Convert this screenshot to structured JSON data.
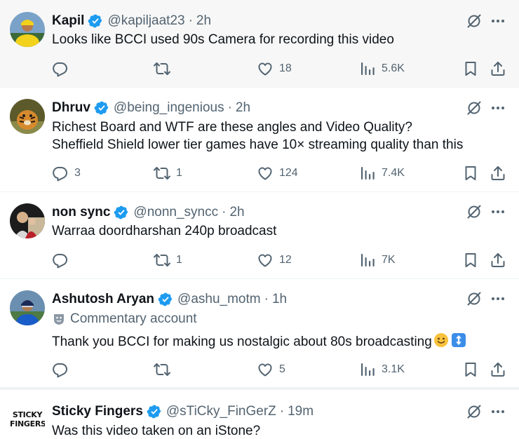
{
  "tweets": [
    {
      "name": "Kapil",
      "handle": "@kapiljaat23",
      "time": "2h",
      "text": "Looks like BCCI used 90s Camera for recording this video",
      "replies": "",
      "retweets": "",
      "likes": "18",
      "views": "5.6K",
      "avatar": "cricketer-yellow-jersey"
    },
    {
      "name": "Dhruv",
      "handle": "@being_ingenious",
      "time": "2h",
      "text_line1": "Richest Board and WTF are these angles and Video Quality?",
      "text_line2": "Sheffield Shield lower tier games have 10× streaming quality than this",
      "replies": "3",
      "retweets": "1",
      "likes": "124",
      "views": "7.4K",
      "avatar": "tiger"
    },
    {
      "name": "non sync",
      "handle": "@nonn_syncc",
      "time": "2h",
      "text": "Warraa doordharshan 240p broadcast",
      "replies": "",
      "retweets": "1",
      "likes": "12",
      "views": "7K",
      "avatar": "person-red"
    },
    {
      "name": "Ashutosh Aryan",
      "handle": "@ashu_motm",
      "time": "1h",
      "label": "Commentary account",
      "text": "Thank you BCCI for making us nostalgic about 80s broadcasting",
      "replies": "",
      "retweets": "",
      "likes": "5",
      "views": "3.1K",
      "avatar": "cricketer-blue-jersey"
    },
    {
      "name": "Sticky Fingers",
      "handle": "@sTiCky_FinGerZ",
      "time": "19m",
      "text": "Was this video taken on an iStone?",
      "avatar_text_1": "STICKY",
      "avatar_text_2": "FINGERS"
    }
  ],
  "separator": "·",
  "colors": {
    "verified": "#1d9bf0",
    "muted": "#536471",
    "text": "#0f1419",
    "highlight_bg": "#f7f7f7"
  },
  "icons": [
    "verified-badge-icon",
    "grok-icon",
    "more-icon",
    "reply-icon",
    "retweet-icon",
    "like-icon",
    "views-icon",
    "bookmark-icon",
    "share-icon",
    "commentary-icon",
    "smile-emoji",
    "up-down-arrow-emoji"
  ]
}
